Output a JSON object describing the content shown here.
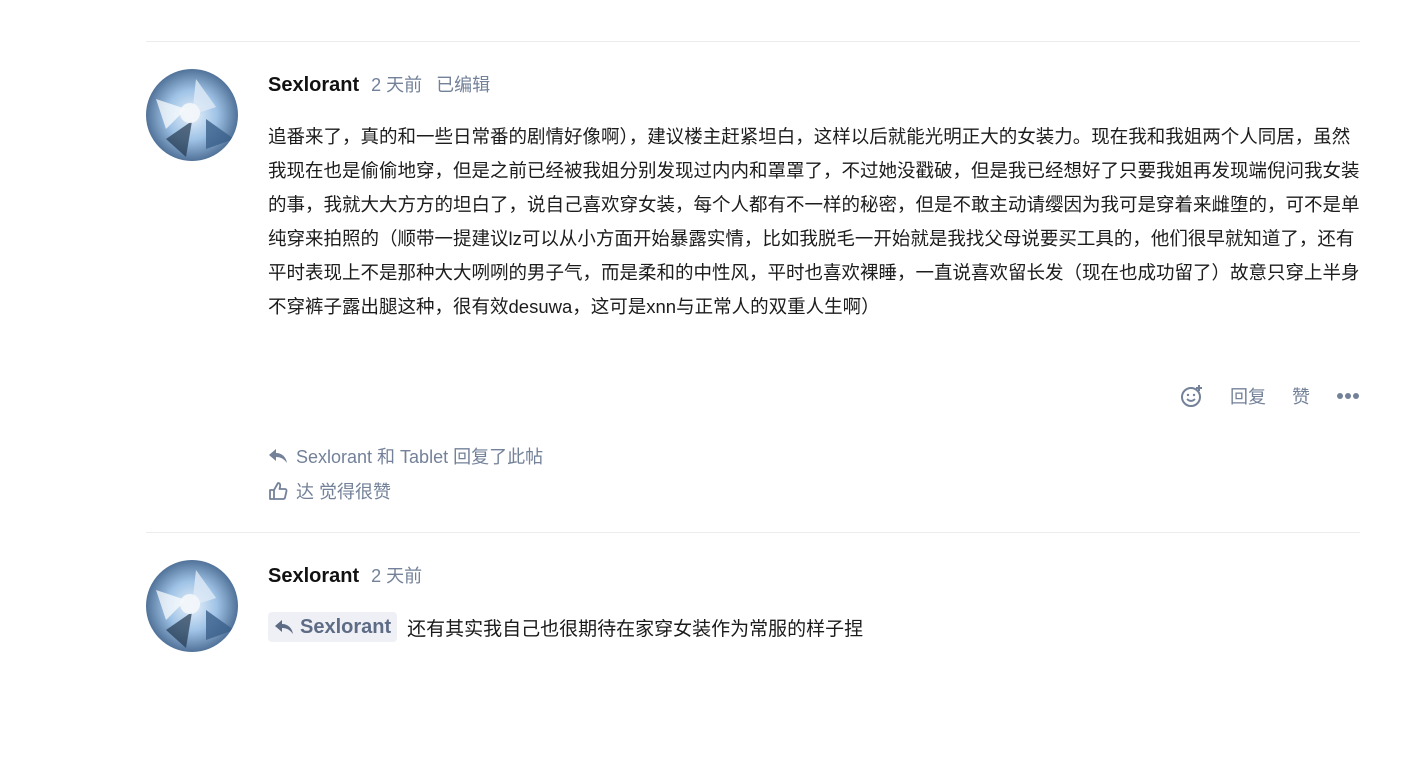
{
  "posts": [
    {
      "author": "Sexlorant",
      "time": "2 天前",
      "edited": "已编辑",
      "avatar_icon": "anime-avatar-icon",
      "body": "追番来了，真的和一些日常番的剧情好像啊），建议楼主赶紧坦白，这样以后就能光明正大的女装力。现在我和我姐两个人同居，虽然我现在也是偷偷地穿，但是之前已经被我姐分别发现过内内和罩罩了，不过她没戳破，但是我已经想好了只要我姐再发现端倪问我女装的事，我就大大方方的坦白了，说自己喜欢穿女装，每个人都有不一样的秘密，但是不敢主动请缨因为我可是穿着来雌堕的，可不是单纯穿来拍照的（顺带一提建议lz可以从小方面开始暴露实情，比如我脱毛一开始就是我找父母说要买工具的，他们很早就知道了，还有平时表现上不是那种大大咧咧的男子气，而是柔和的中性风，平时也喜欢裸睡，一直说喜欢留长发（现在也成功留了）故意只穿上半身不穿裤子露出腿这种，很有效desuwa，这可是xnn与正常人的双重人生啊）",
      "actions": {
        "emoji_icon": "add-reaction-icon",
        "reply": "回复",
        "like": "赞",
        "more_icon": "more-options-icon"
      },
      "replied_by": "Sexlorant 和 Tablet 回复了此帖",
      "liked_by": "达 觉得很赞"
    },
    {
      "author": "Sexlorant",
      "time": "2 天前",
      "avatar_icon": "anime-avatar-icon",
      "reply_to": "Sexlorant",
      "body": "还有其实我自己也很期待在家穿女装作为常服的样子捏"
    }
  ]
}
